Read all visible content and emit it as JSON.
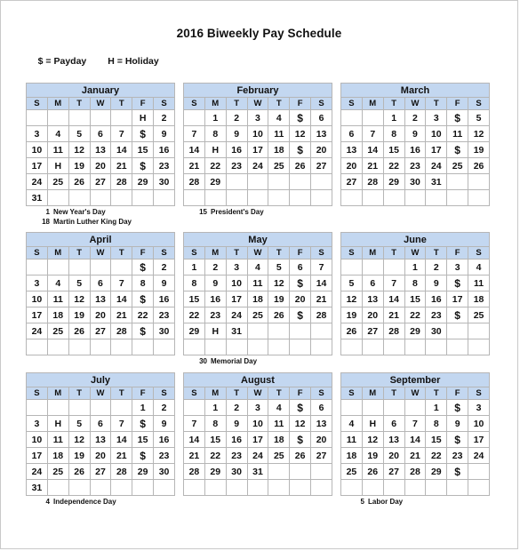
{
  "title": "2016 Biweekly Pay Schedule",
  "legend": {
    "payday": "$ = Payday",
    "holiday": "H = Holiday"
  },
  "symbols": {
    "payday": "$",
    "holiday": "H"
  },
  "colors": {
    "header_bg": "#C3D7F0",
    "grid_border": "#B6B6B6",
    "text": "#111111",
    "page_bg": "#FFFFFF"
  },
  "day_headers": [
    "S",
    "M",
    "T",
    "W",
    "T",
    "F",
    "S"
  ],
  "quarters": [
    {
      "months": [
        {
          "name": "January",
          "weeks": [
            [
              "",
              "",
              "",
              "",
              "",
              "H",
              "2"
            ],
            [
              "3",
              "4",
              "5",
              "6",
              "7",
              "$",
              "9"
            ],
            [
              "10",
              "11",
              "12",
              "13",
              "14",
              "15",
              "16"
            ],
            [
              "17",
              "H",
              "19",
              "20",
              "21",
              "$",
              "23"
            ],
            [
              "24",
              "25",
              "26",
              "27",
              "28",
              "29",
              "30"
            ],
            [
              "31",
              "",
              "",
              "",
              "",
              "",
              ""
            ]
          ],
          "footnotes": [
            {
              "day": "1",
              "label": "New Year's Day"
            },
            {
              "day": "18",
              "label": "Martin Luther King Day"
            }
          ]
        },
        {
          "name": "February",
          "weeks": [
            [
              "",
              "1",
              "2",
              "3",
              "4",
              "$",
              "6"
            ],
            [
              "7",
              "8",
              "9",
              "10",
              "11",
              "12",
              "13"
            ],
            [
              "14",
              "H",
              "16",
              "17",
              "18",
              "$",
              "20"
            ],
            [
              "21",
              "22",
              "23",
              "24",
              "25",
              "26",
              "27"
            ],
            [
              "28",
              "29",
              "",
              "",
              "",
              "",
              ""
            ],
            [
              "",
              "",
              "",
              "",
              "",
              "",
              ""
            ]
          ],
          "footnotes": [
            {
              "day": "15",
              "label": "President's Day"
            }
          ]
        },
        {
          "name": "March",
          "weeks": [
            [
              "",
              "",
              "1",
              "2",
              "3",
              "$",
              "5"
            ],
            [
              "6",
              "7",
              "8",
              "9",
              "10",
              "11",
              "12"
            ],
            [
              "13",
              "14",
              "15",
              "16",
              "17",
              "$",
              "19"
            ],
            [
              "20",
              "21",
              "22",
              "23",
              "24",
              "25",
              "26"
            ],
            [
              "27",
              "28",
              "29",
              "30",
              "31",
              "",
              ""
            ],
            [
              "",
              "",
              "",
              "",
              "",
              "",
              ""
            ]
          ],
          "footnotes": []
        }
      ]
    },
    {
      "months": [
        {
          "name": "April",
          "weeks": [
            [
              "",
              "",
              "",
              "",
              "",
              "$",
              "2"
            ],
            [
              "3",
              "4",
              "5",
              "6",
              "7",
              "8",
              "9"
            ],
            [
              "10",
              "11",
              "12",
              "13",
              "14",
              "$",
              "16"
            ],
            [
              "17",
              "18",
              "19",
              "20",
              "21",
              "22",
              "23"
            ],
            [
              "24",
              "25",
              "26",
              "27",
              "28",
              "$",
              "30"
            ],
            [
              "",
              "",
              "",
              "",
              "",
              "",
              ""
            ]
          ],
          "footnotes": []
        },
        {
          "name": "May",
          "weeks": [
            [
              "1",
              "2",
              "3",
              "4",
              "5",
              "6",
              "7"
            ],
            [
              "8",
              "9",
              "10",
              "11",
              "12",
              "$",
              "14"
            ],
            [
              "15",
              "16",
              "17",
              "18",
              "19",
              "20",
              "21"
            ],
            [
              "22",
              "23",
              "24",
              "25",
              "26",
              "$",
              "28"
            ],
            [
              "29",
              "H",
              "31",
              "",
              "",
              "",
              ""
            ],
            [
              "",
              "",
              "",
              "",
              "",
              "",
              ""
            ]
          ],
          "footnotes": [
            {
              "day": "30",
              "label": "Memorial Day"
            }
          ]
        },
        {
          "name": "June",
          "weeks": [
            [
              "",
              "",
              "",
              "1",
              "2",
              "3",
              "4"
            ],
            [
              "5",
              "6",
              "7",
              "8",
              "9",
              "$",
              "11"
            ],
            [
              "12",
              "13",
              "14",
              "15",
              "16",
              "17",
              "18"
            ],
            [
              "19",
              "20",
              "21",
              "22",
              "23",
              "$",
              "25"
            ],
            [
              "26",
              "27",
              "28",
              "29",
              "30",
              "",
              ""
            ],
            [
              "",
              "",
              "",
              "",
              "",
              "",
              ""
            ]
          ],
          "footnotes": []
        }
      ]
    },
    {
      "months": [
        {
          "name": "July",
          "weeks": [
            [
              "",
              "",
              "",
              "",
              "",
              "1",
              "2"
            ],
            [
              "3",
              "H",
              "5",
              "6",
              "7",
              "$",
              "9"
            ],
            [
              "10",
              "11",
              "12",
              "13",
              "14",
              "15",
              "16"
            ],
            [
              "17",
              "18",
              "19",
              "20",
              "21",
              "$",
              "23"
            ],
            [
              "24",
              "25",
              "26",
              "27",
              "28",
              "29",
              "30"
            ],
            [
              "31",
              "",
              "",
              "",
              "",
              "",
              ""
            ]
          ],
          "footnotes": [
            {
              "day": "4",
              "label": "Independence Day"
            }
          ]
        },
        {
          "name": "August",
          "weeks": [
            [
              "",
              "1",
              "2",
              "3",
              "4",
              "$",
              "6"
            ],
            [
              "7",
              "8",
              "9",
              "10",
              "11",
              "12",
              "13"
            ],
            [
              "14",
              "15",
              "16",
              "17",
              "18",
              "$",
              "20"
            ],
            [
              "21",
              "22",
              "23",
              "24",
              "25",
              "26",
              "27"
            ],
            [
              "28",
              "29",
              "30",
              "31",
              "",
              "",
              ""
            ],
            [
              "",
              "",
              "",
              "",
              "",
              "",
              ""
            ]
          ],
          "footnotes": []
        },
        {
          "name": "September",
          "weeks": [
            [
              "",
              "",
              "",
              "",
              "1",
              "$",
              "3"
            ],
            [
              "4",
              "H",
              "6",
              "7",
              "8",
              "9",
              "10"
            ],
            [
              "11",
              "12",
              "13",
              "14",
              "15",
              "$",
              "17"
            ],
            [
              "18",
              "19",
              "20",
              "21",
              "22",
              "23",
              "24"
            ],
            [
              "25",
              "26",
              "27",
              "28",
              "29",
              "$",
              ""
            ],
            [
              "",
              "",
              "",
              "",
              "",
              "",
              ""
            ]
          ],
          "footnotes": [
            {
              "day": "5",
              "label": "Labor Day"
            }
          ]
        }
      ]
    }
  ]
}
